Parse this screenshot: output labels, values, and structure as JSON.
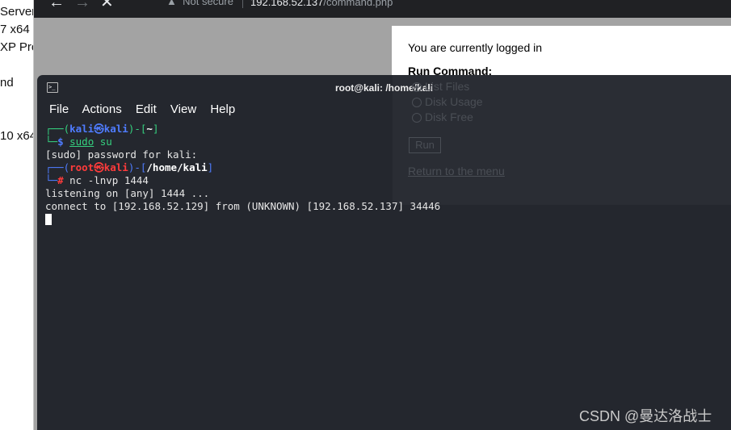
{
  "left_window": {
    "items": [
      "Server",
      "7 x64",
      "XP Pro",
      "nd",
      "10 x64"
    ]
  },
  "browser": {
    "back_icon": "arrow-left-icon",
    "forward_icon": "arrow-right-icon",
    "close_icon": "close-icon",
    "security_text": "Not secure",
    "url_host": "192.168.52.137",
    "url_path": "/command.php"
  },
  "webpage": {
    "logged_in_text": "You are currently logged in",
    "run_command_label": "Run Command:",
    "options": [
      "List Files",
      "Disk Usage",
      "Disk Free"
    ],
    "selected_option": "List Files",
    "run_button": "Run",
    "return_link": "Return to the menu"
  },
  "terminal": {
    "title": "root@kali: /home/kali",
    "menu": [
      "File",
      "Actions",
      "Edit",
      "View",
      "Help"
    ],
    "lines": {
      "prompt1_open": "┌──(",
      "prompt1_user": "kali㉿kali",
      "prompt1_mid": ")-[",
      "prompt1_dir": "~",
      "prompt1_close": "]",
      "prompt1_tail": "└─",
      "prompt1_sym": "$",
      "cmd1_a": "sudo",
      "cmd1_b": " su",
      "sudo_prompt": "[sudo] password for kali:",
      "prompt2_open": "┌──(",
      "prompt2_user": "root㉿kali",
      "prompt2_mid": ")-[",
      "prompt2_dir": "/home/kali",
      "prompt2_close": "]",
      "prompt2_tail": "└─",
      "prompt2_sym": "#",
      "cmd2": " nc -lnvp 1444",
      "listening": "listening on [any] 1444 ...",
      "connect": "connect to [192.168.52.129] from (UNKNOWN) [192.168.52.137] 34446"
    }
  },
  "watermark": "CSDN @曼达洛战士"
}
